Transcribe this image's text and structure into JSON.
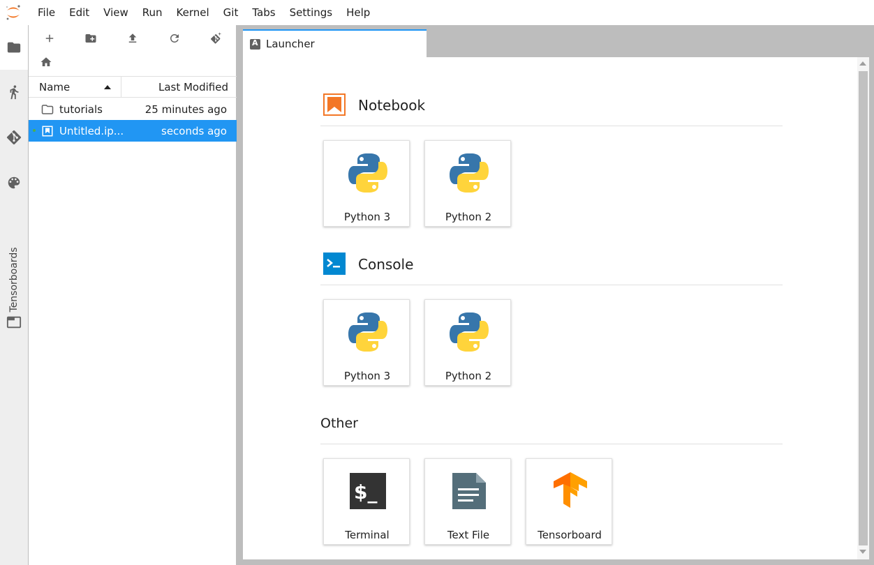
{
  "menubar": {
    "items": [
      "File",
      "Edit",
      "View",
      "Run",
      "Kernel",
      "Git",
      "Tabs",
      "Settings",
      "Help"
    ]
  },
  "activitybar": {
    "tensorboards_label": "Tensorboards"
  },
  "filebrowser": {
    "header": {
      "name": "Name",
      "last_modified": "Last Modified"
    },
    "rows": [
      {
        "name": "tutorials",
        "modified": "25 minutes ago",
        "type": "folder"
      },
      {
        "name": "Untitled.ip...",
        "modified": "seconds ago",
        "type": "notebook"
      }
    ]
  },
  "tab": {
    "label": "Launcher"
  },
  "launcher": {
    "notebook": {
      "title": "Notebook",
      "cards": [
        "Python 3",
        "Python 2"
      ]
    },
    "console": {
      "title": "Console",
      "cards": [
        "Python 3",
        "Python 2"
      ]
    },
    "other": {
      "title": "Other",
      "cards": [
        "Terminal",
        "Text File",
        "Tensorboard"
      ]
    }
  },
  "colors": {
    "accent": "#2196f3",
    "notebook_orange": "#f37726",
    "console_blue": "#0288d1",
    "python_blue": "#3776ab",
    "python_yellow": "#ffd43b",
    "tensorflow_orange": "#ff6f00"
  }
}
